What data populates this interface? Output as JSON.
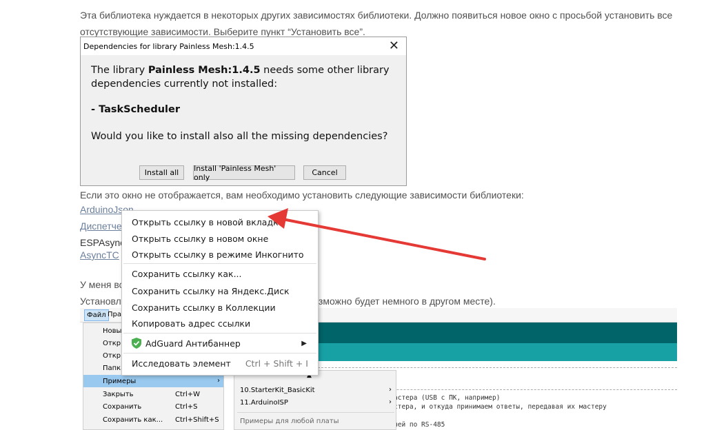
{
  "article": {
    "p1_line1": "Эта библиотека нуждается в некоторых других зависимостях библиотеки. Должно появиться новое окно с просьбой установить все",
    "p1_line2": "отсутствующие зависимости. Выберите пункт “Установить все”.",
    "p2": "Если это окно не отображается, вам необходимо установить следующие зависимости библиотеки:",
    "dep_links": [
      "ArduinoJson",
      "Диспетче",
      "ESPAsync",
      "AsyncTC"
    ],
    "p3_start": "У меня вс",
    "p4_start": "Установл",
    "p4_end": "зможно будет немного в другом месте)."
  },
  "dialog": {
    "title": "Dependencies for library Painless Mesh:1.4.5",
    "close_glyph": "✕",
    "msg_pre": "The library ",
    "msg_lib": "Painless Mesh:1.4.5",
    "msg_post": " needs some other library",
    "msg_line2": "dependencies currently not installed:",
    "dependency": "- TaskScheduler",
    "question": "Would you like to install also all the missing dependencies?",
    "btn_install_all": "Install all",
    "btn_install_only": "Install 'Painless Mesh' only",
    "btn_cancel": "Cancel"
  },
  "context_menu": {
    "open_new_tab": "Открыть ссылку в новой вкладке",
    "open_new_window": "Открыть ссылку в новом окне",
    "open_incognito": "Открыть ссылку в режиме Инкогнито",
    "save_link_as": "Сохранить ссылку как...",
    "save_yandex_disk": "Сохранить ссылку на Яндекс.Диск",
    "save_collections": "Сохранить ссылку в Коллекции",
    "copy_link": "Копировать адрес ссылки",
    "adguard": "AdGuard Антибаннер",
    "inspect": "Исследовать элемент",
    "inspect_shortcut": "Ctrl + Shift + I",
    "chevron": "▶"
  },
  "ide": {
    "menu_file": "Файл",
    "menu_edit": "Пра",
    "file_items": {
      "new": "Новы",
      "open": "Откр",
      "open_recent": "Откр",
      "sketchbook": "Папка",
      "examples": "Примеры",
      "close": "Закрыть",
      "close_sc": "Ctrl+W",
      "save": "Сохранить",
      "save_sc": "Ctrl+S",
      "save_as": "Сохранить как...",
      "save_as_sc": "Ctrl+Shift+S",
      "examples_chev": "›"
    },
    "submenu": {
      "up_arrow": "▲",
      "starterkit": "10.StarterKit_BasicKit",
      "arduinoisp": "11.ArduinoISP",
      "any_board": "Примеры для любой платы",
      "chev": "›"
    },
    "code_line1": "астера (USB с ПК, например)",
    "code_line2": "стера, и откуда принимаем ответы, передавая их мастеру",
    "code_line3": "чей по RS-485"
  },
  "colors": {
    "arrow": "#e53935",
    "teal_dark": "#006468",
    "teal_light": "#17a1a5",
    "adguard_green": "#4caf50"
  }
}
